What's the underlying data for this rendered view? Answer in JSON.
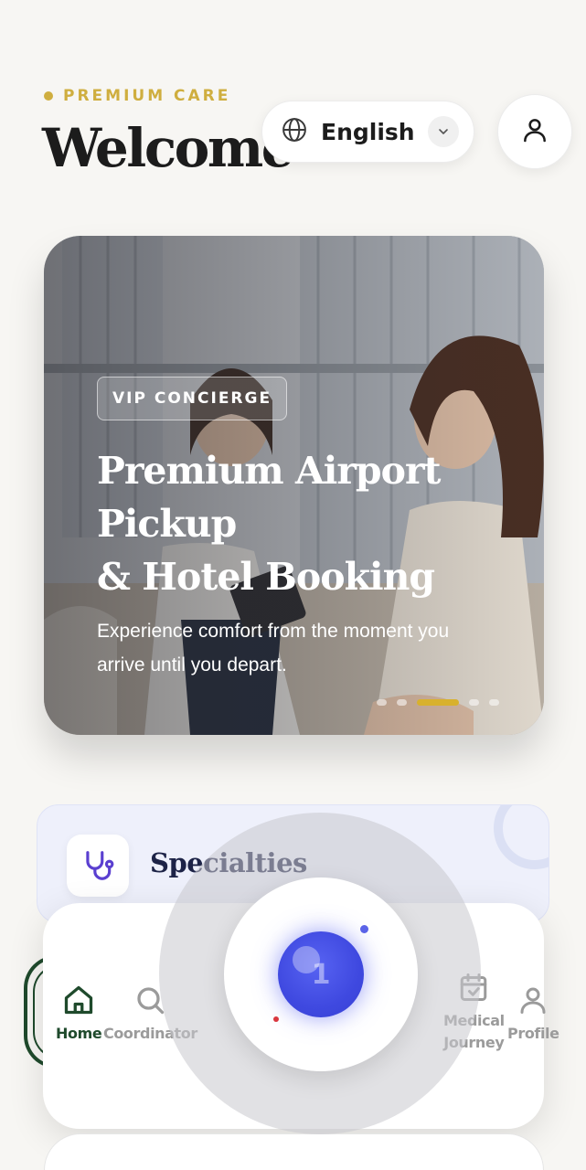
{
  "header": {
    "eyebrow": "PREMIUM CARE",
    "title": "Welcome"
  },
  "language": {
    "label": "English",
    "icon": "globe-icon"
  },
  "hero": {
    "badge": "VIP CONCIERGE",
    "title_lines": [
      "Premium Airport",
      "Pickup",
      "& Hotel Booking"
    ],
    "subtitle": "Experience comfort from the moment you arrive until you depart.",
    "carousel_total": 5,
    "carousel_active_index": 3
  },
  "specialties": {
    "title": "Specialties",
    "icon": "stethoscope-icon"
  },
  "nav": {
    "items": [
      {
        "label": "Home",
        "icon": "home-icon",
        "active": true
      },
      {
        "label": "Coordinator",
        "icon": "search-icon",
        "active": false
      },
      {
        "label_line1": "Medical",
        "label_line2": "Journey",
        "icon": "calendar-check-icon",
        "active": false
      },
      {
        "label": "Profile",
        "icon": "user-icon",
        "active": false
      }
    ]
  },
  "assistant": {
    "badge_count": "1"
  },
  "colors": {
    "gold": "#cfae3f",
    "green": "#1f4a2c",
    "indigo": "#3f49e0",
    "navy": "#1d2347"
  }
}
